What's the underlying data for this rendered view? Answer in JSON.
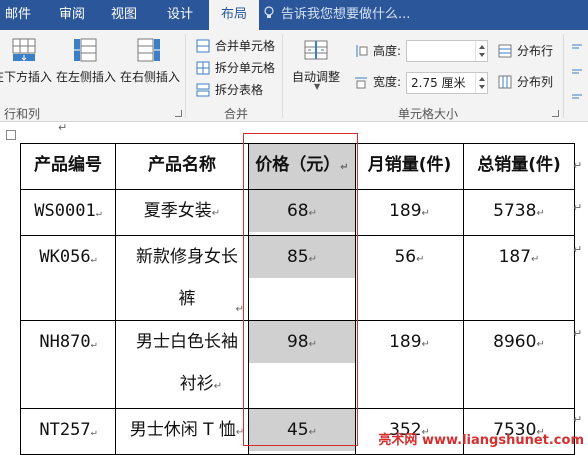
{
  "tabs": [
    {
      "label": "邮件",
      "active": false
    },
    {
      "label": "审阅",
      "active": false
    },
    {
      "label": "视图",
      "active": false
    },
    {
      "label": "设计",
      "active": false
    },
    {
      "label": "布局",
      "active": true
    }
  ],
  "tell_me": "告诉我您想要做什么...",
  "ribbon": {
    "rows_cols": {
      "insert_below": "在下方插入",
      "insert_left": "在左侧插入",
      "insert_right": "在右侧插入",
      "group_label": "行和列"
    },
    "merge": {
      "merge_cells": "合并单元格",
      "split_cells": "拆分单元格",
      "split_table": "拆分表格",
      "group_label": "合并"
    },
    "cell_size": {
      "autofit": "自动调整",
      "height_label": "高度:",
      "height_value": "",
      "width_label": "宽度:",
      "width_value": "2.75 厘米",
      "distribute_rows": "分布行",
      "distribute_cols": "分布列",
      "group_label": "单元格大小"
    }
  },
  "table": {
    "headers": [
      "产品编号",
      "产品名称",
      "价格（元）",
      "月销量(件)",
      "总销量(件)"
    ],
    "rows": [
      {
        "code": "WS0001",
        "name_line1": "夏季女装",
        "name_line2": "",
        "price": "68",
        "monthly": "189",
        "total": "5738"
      },
      {
        "code": "WK056",
        "name_line1": "新款修身女长",
        "name_line2": "裤",
        "price": "85",
        "monthly": "56",
        "total": "187"
      },
      {
        "code": "NH870",
        "name_line1": "男士白色长袖",
        "name_line2": "衬衫",
        "price": "98",
        "monthly": "189",
        "total": "8960"
      },
      {
        "code": "NT257",
        "name_line1": "男士休闲 T 恤",
        "name_line2": "",
        "price": "45",
        "monthly": "352",
        "total": "7530"
      }
    ]
  },
  "watermark": "亮术网 www.liangshunet.com",
  "colors": {
    "accent": "#2b579a",
    "selection": "#d0d0d0",
    "highlight_box": "#d32f2f"
  }
}
